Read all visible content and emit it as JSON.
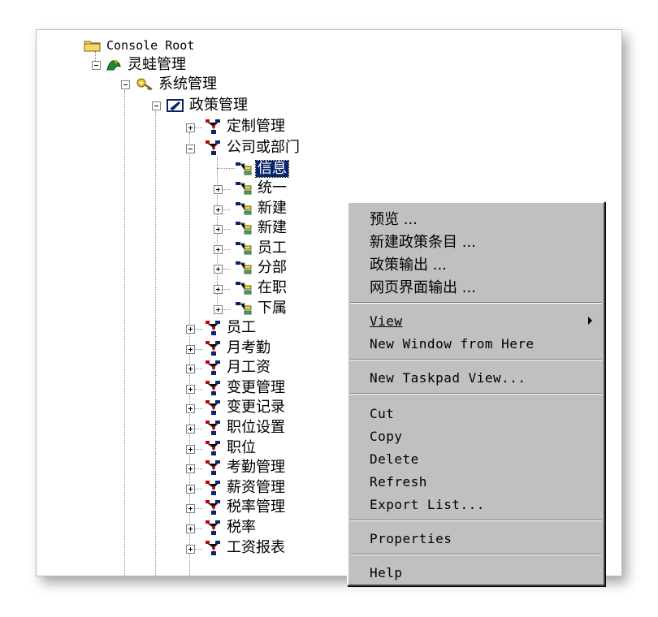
{
  "tree": {
    "root": {
      "label": "Console Root",
      "icon": "folder-icon"
    },
    "app": {
      "label": "灵蛙管理",
      "icon": "snapin-icon"
    },
    "system": {
      "label": "系统管理",
      "icon": "key-icon"
    },
    "policy": {
      "label": "政策管理",
      "icon": "policy-icon"
    },
    "customize": {
      "label": "定制管理",
      "icon": "network-icon"
    },
    "company": {
      "label": "公司或部门",
      "icon": "network-icon"
    },
    "info": {
      "label": "信息",
      "icon": "leaf-node-icon"
    },
    "children": [
      {
        "label": "统一"
      },
      {
        "label": "新建"
      },
      {
        "label": "新建"
      },
      {
        "label": "员工"
      },
      {
        "label": "分部"
      },
      {
        "label": "在职"
      },
      {
        "label": "下属"
      }
    ],
    "siblings": [
      {
        "label": "员工"
      },
      {
        "label": "月考勤"
      },
      {
        "label": "月工资"
      },
      {
        "label": "变更管理"
      },
      {
        "label": "变更记录"
      },
      {
        "label": "职位设置"
      },
      {
        "label": "职位"
      },
      {
        "label": "考勤管理"
      },
      {
        "label": "薪资管理"
      },
      {
        "label": "税率管理"
      },
      {
        "label": "税率"
      },
      {
        "label": "工资报表"
      }
    ]
  },
  "menu": {
    "preview": "预览 ...",
    "new_policy_item": "新建政策条目 ...",
    "policy_output": "政策输出 ...",
    "web_output": "网页界面输出 ...",
    "view": "View",
    "new_window": "New Window from Here",
    "new_taskpad": "New Taskpad View...",
    "cut": "Cut",
    "copy": "Copy",
    "delete": "Delete",
    "refresh": "Refresh",
    "export_list": "Export List...",
    "properties": "Properties",
    "help": "Help"
  }
}
